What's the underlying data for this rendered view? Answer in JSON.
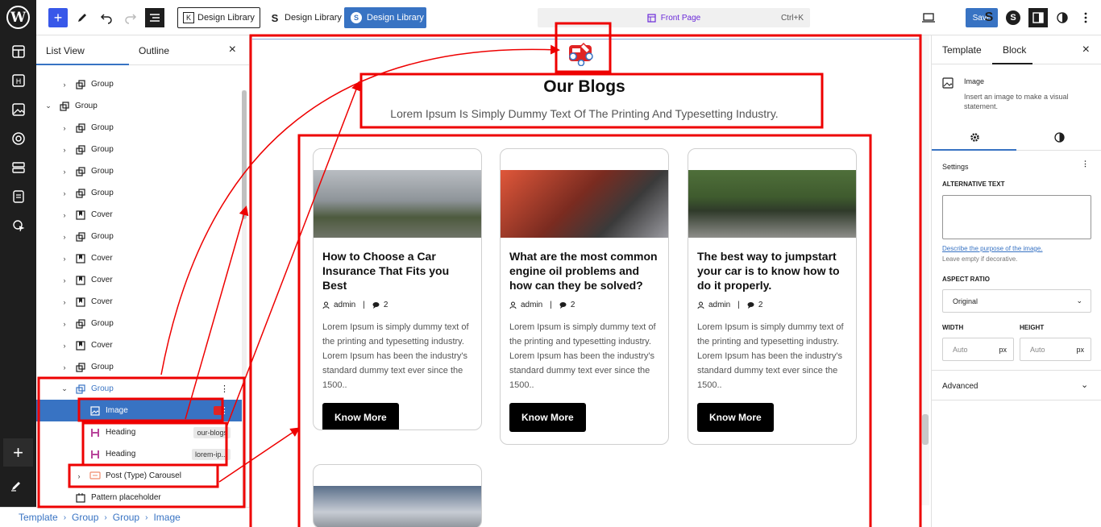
{
  "toolbar": {
    "design_library_1": "Design Library",
    "design_library_2": "Design Library",
    "design_library_3": "Design Library",
    "command_page": "Front Page",
    "command_shortcut": "Ctrl+K",
    "save_label": "Save"
  },
  "list_view": {
    "tab_list": "List View",
    "tab_outline": "Outline",
    "rows": [
      {
        "label": "Group",
        "top": 0
      },
      {
        "label": "Group"
      },
      {
        "label": "Group"
      },
      {
        "label": "Group"
      },
      {
        "label": "Group"
      },
      {
        "label": "Group"
      },
      {
        "label": "Cover"
      },
      {
        "label": "Group"
      },
      {
        "label": "Cover"
      },
      {
        "label": "Cover"
      },
      {
        "label": "Cover"
      },
      {
        "label": "Group"
      },
      {
        "label": "Cover"
      },
      {
        "label": "Group"
      },
      {
        "label": "Group"
      },
      {
        "label": "Image"
      },
      {
        "label": "Heading",
        "tag": "our-blogs"
      },
      {
        "label": "Heading",
        "tag": "lorem-ip..."
      },
      {
        "label": "Post (Type) Carousel"
      },
      {
        "label": "Pattern placeholder"
      }
    ]
  },
  "breadcrumb": [
    "Template",
    "Group",
    "Group",
    "Image"
  ],
  "canvas": {
    "title": "Our Blogs",
    "subtitle": "Lorem Ipsum Is Simply Dummy Text Of The Printing And Typesetting Industry.",
    "cards": [
      {
        "title": "How to Choose a Car Insurance That Fits you Best",
        "author": "admin",
        "comments": "2",
        "desc": "Lorem Ipsum is simply dummy text of the printing and typesetting industry. Lorem Ipsum has been the industry's standard dummy text ever since the 1500..",
        "button": "Know More"
      },
      {
        "title": "What are the most common engine oil problems and how can they be solved?",
        "author": "admin",
        "comments": "2",
        "desc": "Lorem Ipsum is simply dummy text of the printing and typesetting industry. Lorem Ipsum has been the industry's standard dummy text ever since the 1500..",
        "button": "Know More"
      },
      {
        "title": "The best way to jumpstart your car is to know how to do it properly.",
        "author": "admin",
        "comments": "2",
        "desc": "Lorem Ipsum is simply dummy text of the printing and typesetting industry. Lorem Ipsum has been the industry's standard dummy text ever since the 1500..",
        "button": "Know More"
      }
    ]
  },
  "sidebar": {
    "tab_template": "Template",
    "tab_block": "Block",
    "block_name": "Image",
    "block_desc": "Insert an image to make a visual statement.",
    "settings_label": "Settings",
    "alt_text_label": "ALTERNATIVE TEXT",
    "alt_link": "Describe the purpose of the image.",
    "alt_help": "Leave empty if decorative.",
    "aspect_label": "ASPECT RATIO",
    "aspect_value": "Original",
    "width_label": "WIDTH",
    "height_label": "HEIGHT",
    "width_placeholder": "Auto",
    "height_placeholder": "Auto",
    "unit": "px",
    "advanced_label": "Advanced"
  },
  "colors": {
    "accent": "#3873c3",
    "annotation": "#ee0000",
    "dark": "#1e1e1e"
  }
}
